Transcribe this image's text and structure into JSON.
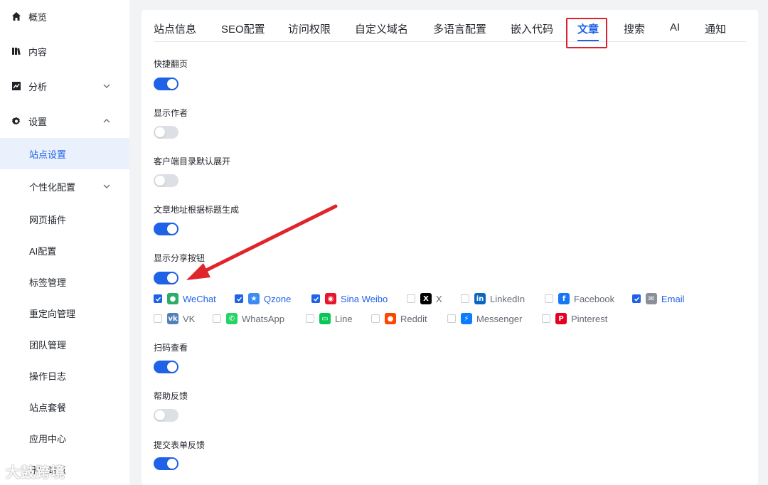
{
  "sidebar": {
    "overview": "概览",
    "content": "内容",
    "analytics": "分析",
    "settings": "设置",
    "sub": {
      "site_settings": "站点设置",
      "personalization": "个性化配置",
      "plugins": "网页插件",
      "ai_config": "AI配置",
      "tag_manage": "标签管理",
      "redirect_manage": "重定向管理",
      "team_manage": "团队管理",
      "op_log": "操作日志",
      "site_plan": "站点套餐",
      "app_center": "应用中心",
      "delete_site": "删除站点"
    }
  },
  "tabs": [
    "站点信息",
    "SEO配置",
    "访问权限",
    "自定义域名",
    "多语言配置",
    "嵌入代码",
    "文章",
    "搜索",
    "AI",
    "通知"
  ],
  "active_tab": "文章",
  "settings": [
    {
      "label": "快捷翻页",
      "enabled": true
    },
    {
      "label": "显示作者",
      "enabled": false
    },
    {
      "label": "客户端目录默认展开",
      "enabled": false
    },
    {
      "label": "文章地址根据标题生成",
      "enabled": true
    },
    {
      "label": "显示分享按钮",
      "enabled": true
    },
    {
      "label": "扫码查看",
      "enabled": true
    },
    {
      "label": "帮助反馈",
      "enabled": false
    },
    {
      "label": "提交表单反馈",
      "enabled": true
    }
  ],
  "share": [
    {
      "name": "WeChat",
      "checked": true,
      "icon": "wechat-icon",
      "color": "#2aae67"
    },
    {
      "name": "Qzone",
      "checked": true,
      "icon": "qzone-icon",
      "color": "#3d8bf2"
    },
    {
      "name": "Sina Weibo",
      "checked": true,
      "icon": "weibo-icon",
      "color": "#e6162d"
    },
    {
      "name": "X",
      "checked": false,
      "icon": "x-icon",
      "color": "#000000"
    },
    {
      "name": "LinkedIn",
      "checked": false,
      "icon": "linkedin-icon",
      "color": "#0a66c2"
    },
    {
      "name": "Facebook",
      "checked": false,
      "icon": "facebook-icon",
      "color": "#1877f2"
    },
    {
      "name": "Email",
      "checked": true,
      "icon": "email-icon",
      "color": "#8a8f99"
    },
    {
      "name": "VK",
      "checked": false,
      "icon": "vk-icon",
      "color": "#5181b8"
    },
    {
      "name": "WhatsApp",
      "checked": false,
      "icon": "whatsapp-icon",
      "color": "#25d366"
    },
    {
      "name": "Line",
      "checked": false,
      "icon": "line-icon",
      "color": "#06c755"
    },
    {
      "name": "Reddit",
      "checked": false,
      "icon": "reddit-icon",
      "color": "#ff4500"
    },
    {
      "name": "Messenger",
      "checked": false,
      "icon": "messenger-icon",
      "color": "#0a7cff"
    },
    {
      "name": "Pinterest",
      "checked": false,
      "icon": "pinterest-icon",
      "color": "#e60023"
    }
  ],
  "colors": {
    "accent": "#1f62e8",
    "highlight": "#d9232e",
    "arrow": "#e0242c"
  },
  "watermark": "大鼓跨境"
}
